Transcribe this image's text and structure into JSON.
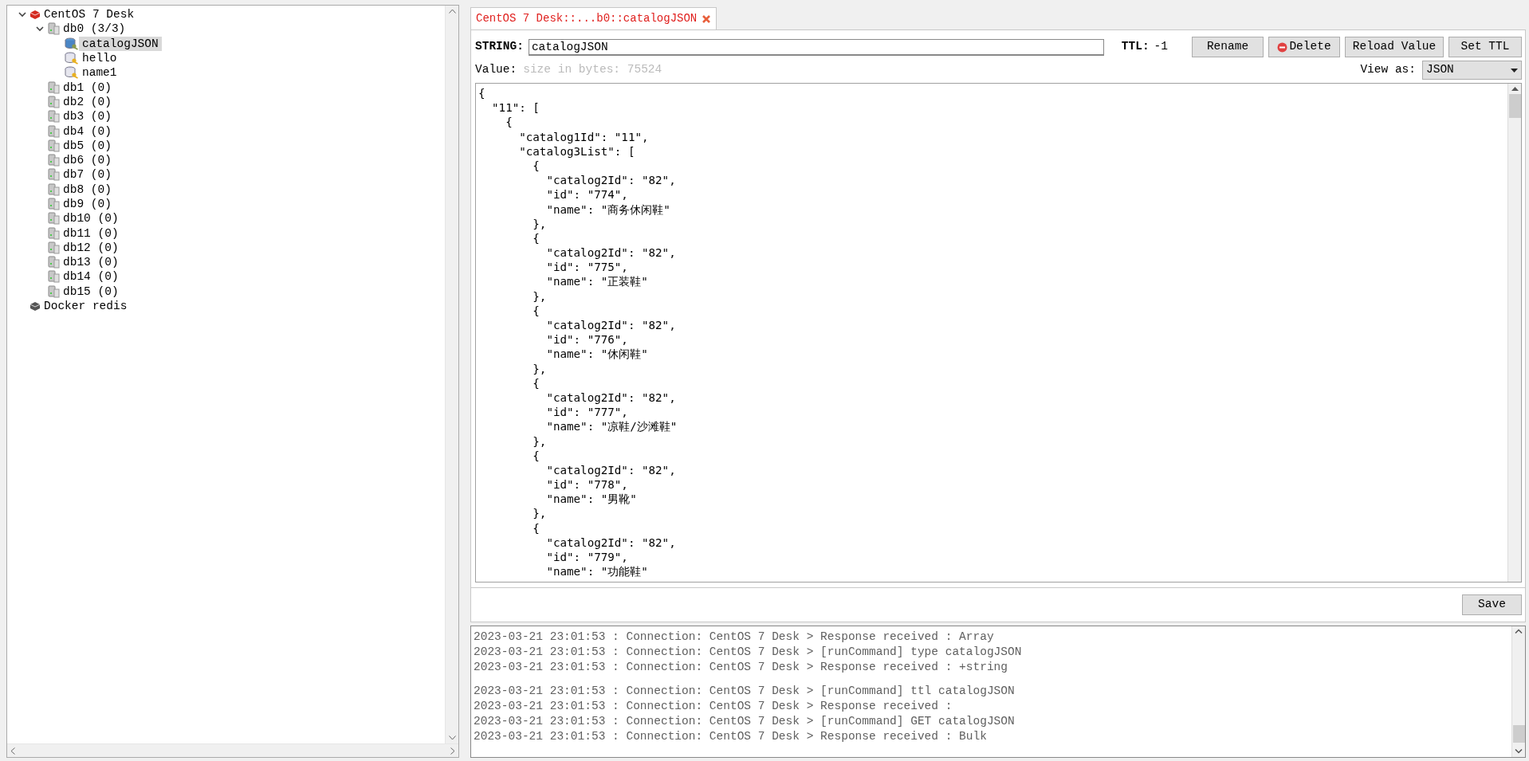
{
  "tree": [
    {
      "label": "CentOS 7 Desk",
      "kind": "connection",
      "connected": true,
      "expanded": true,
      "children": [
        {
          "label": "db0  (3/3)",
          "kind": "database",
          "expanded": true,
          "children": [
            {
              "label": "catalogJSON",
              "kind": "key",
              "selected": true
            },
            {
              "label": "hello",
              "kind": "key",
              "selected": false
            },
            {
              "label": "name1",
              "kind": "key",
              "selected": false
            }
          ]
        },
        {
          "label": "db1 (0)",
          "kind": "database"
        },
        {
          "label": "db2 (0)",
          "kind": "database"
        },
        {
          "label": "db3 (0)",
          "kind": "database"
        },
        {
          "label": "db4 (0)",
          "kind": "database"
        },
        {
          "label": "db5 (0)",
          "kind": "database"
        },
        {
          "label": "db6 (0)",
          "kind": "database"
        },
        {
          "label": "db7 (0)",
          "kind": "database"
        },
        {
          "label": "db8 (0)",
          "kind": "database"
        },
        {
          "label": "db9 (0)",
          "kind": "database"
        },
        {
          "label": "db10 (0)",
          "kind": "database"
        },
        {
          "label": "db11 (0)",
          "kind": "database"
        },
        {
          "label": "db12 (0)",
          "kind": "database"
        },
        {
          "label": "db13 (0)",
          "kind": "database"
        },
        {
          "label": "db14 (0)",
          "kind": "database"
        },
        {
          "label": "db15 (0)",
          "kind": "database"
        }
      ]
    },
    {
      "label": "Docker redis",
      "kind": "connection",
      "connected": false
    }
  ],
  "tabs": [
    {
      "label": "CentOS 7 Desk::...b0::catalogJSON",
      "selected": true
    }
  ],
  "key_bar": {
    "type_label": "STRING:",
    "key_name": "catalogJSON",
    "ttl_label": "TTL:",
    "ttl_value": "-1",
    "buttons": [
      {
        "label": "Rename",
        "kind": "plain"
      },
      {
        "label": "Delete",
        "kind": "delete"
      },
      {
        "label": "Reload Value",
        "kind": "plain"
      },
      {
        "label": "Set TTL",
        "kind": "plain"
      }
    ]
  },
  "value_bar": {
    "label": "Value:",
    "size": "size in bytes: 75524",
    "view_as_label": "View as:",
    "view_as": "JSON"
  },
  "editor_lines": [
    "{",
    "  \"11\": [",
    "    {",
    "      \"catalog1Id\": \"11\",",
    "      \"catalog3List\": [",
    "        {",
    "          \"catalog2Id\": \"82\",",
    "          \"id\": \"774\",",
    "          \"name\": \"商务休闲鞋\"",
    "        },",
    "        {",
    "          \"catalog2Id\": \"82\",",
    "          \"id\": \"775\",",
    "          \"name\": \"正装鞋\"",
    "        },",
    "        {",
    "          \"catalog2Id\": \"82\",",
    "          \"id\": \"776\",",
    "          \"name\": \"休闲鞋\"",
    "        },",
    "        {",
    "          \"catalog2Id\": \"82\",",
    "          \"id\": \"777\",",
    "          \"name\": \"凉鞋/沙滩鞋\"",
    "        },",
    "        {",
    "          \"catalog2Id\": \"82\",",
    "          \"id\": \"778\",",
    "          \"name\": \"男靴\"",
    "        },",
    "        {",
    "          \"catalog2Id\": \"82\",",
    "          \"id\": \"779\",",
    "          \"name\": \"功能鞋\""
  ],
  "save_button": "Save",
  "log_groups": [
    {
      "lines": [
        "2023-03-21 23:01:53 : Connection: CentOS 7 Desk > Response received : Array",
        "2023-03-21 23:01:53 : Connection: CentOS 7 Desk > [runCommand] type catalogJSON",
        "2023-03-21 23:01:53 : Connection: CentOS 7 Desk > Response received : +string"
      ]
    },
    {
      "lines": [
        "2023-03-21 23:01:53 : Connection: CentOS 7 Desk > [runCommand] ttl catalogJSON",
        "2023-03-21 23:01:53 : Connection: CentOS 7 Desk > Response received :",
        "2023-03-21 23:01:53 : Connection: CentOS 7 Desk > [runCommand] GET catalogJSON",
        "2023-03-21 23:01:53 : Connection: CentOS 7 Desk > Response received : Bulk"
      ]
    }
  ]
}
